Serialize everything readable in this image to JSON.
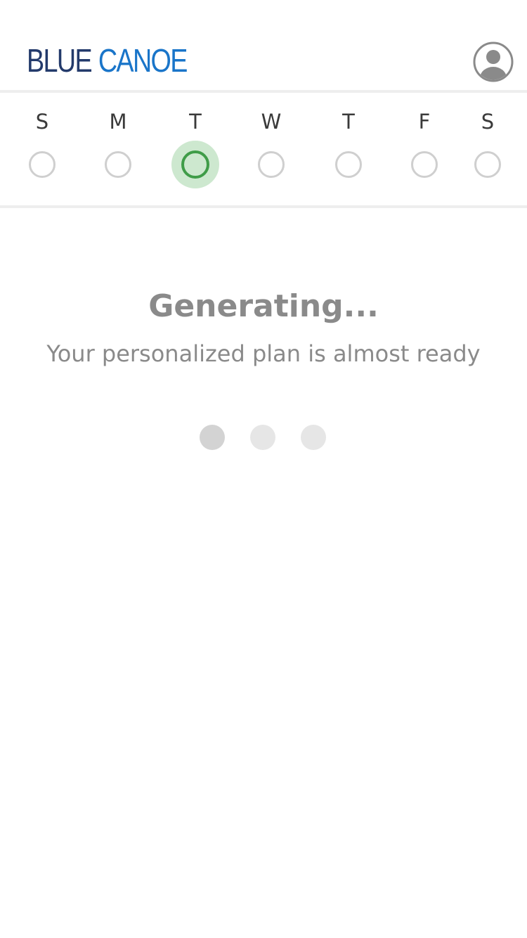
{
  "header": {
    "logo_word1": "BLUE",
    "logo_word2": "CANOE",
    "logo_colors": {
      "word1": "#233a6b",
      "word2": "#1a75c9"
    },
    "profile_icon": "user-avatar-icon"
  },
  "week": {
    "days": [
      {
        "label": "S",
        "selected": false
      },
      {
        "label": "M",
        "selected": false
      },
      {
        "label": "T",
        "selected": true
      },
      {
        "label": "W",
        "selected": false
      },
      {
        "label": "T",
        "selected": false
      },
      {
        "label": "F",
        "selected": false
      },
      {
        "label": "S",
        "selected": false
      }
    ],
    "selected_color": "#3f9c48"
  },
  "status": {
    "title": "Generating...",
    "subtitle": "Your personalized plan is almost ready"
  },
  "loader": {
    "dot_count": 3,
    "active_dot": 1
  }
}
